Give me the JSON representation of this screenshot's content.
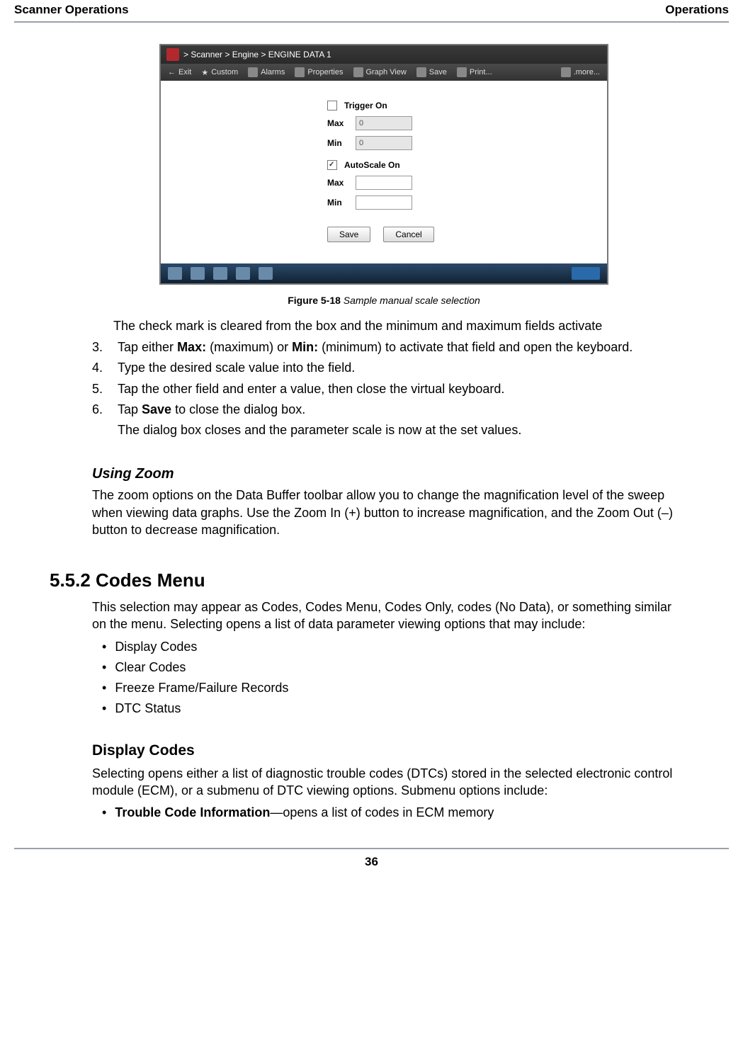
{
  "header": {
    "left": "Scanner Operations",
    "right": "Operations"
  },
  "figure": {
    "breadcrumb": "> Scanner  > Engine  > ENGINE DATA 1",
    "toolbar": {
      "exit": "Exit",
      "custom": "Custom",
      "alarms": "Alarms",
      "properties": "Properties",
      "graphview": "Graph View",
      "save": "Save",
      "print": "Print...",
      "more": ".more..."
    },
    "form": {
      "trigger_on": "Trigger On",
      "max": "Max",
      "min": "Min",
      "autoscale_on": "AutoScale On",
      "trigger_max_val": "0",
      "trigger_min_val": "0",
      "save_btn": "Save",
      "cancel_btn": "Cancel"
    },
    "caption_bold": "Figure 5-18",
    "caption_italic": " Sample manual scale selection"
  },
  "body": {
    "intro": "The check mark is cleared from the box and the minimum and maximum fields activate",
    "step3_num": "3.",
    "step3_a": "Tap either ",
    "step3_b": "Max:",
    "step3_c": " (maximum) or ",
    "step3_d": "Min:",
    "step3_e": " (minimum) to activate that field and open the keyboard.",
    "step4_num": "4.",
    "step4": "Type the desired scale value into the field.",
    "step5_num": "5.",
    "step5": "Tap the other field and enter a value, then close the virtual keyboard.",
    "step6_num": "6.",
    "step6_a": "Tap ",
    "step6_b": "Save",
    "step6_c": " to close the dialog box.",
    "step6_sub": "The dialog box closes and the parameter scale is now at the set values.",
    "zoom_h": "Using Zoom",
    "zoom_p": "The zoom options on the Data Buffer toolbar allow you to change the magnification level of the sweep when viewing data graphs. Use the Zoom In (+) button to increase magnification, and the Zoom Out (–) button to decrease magnification.",
    "sec_h": "5.5.2  Codes Menu",
    "sec_p": "This selection may appear as Codes, Codes Menu, Codes Only, codes (No Data), or something similar on the menu. Selecting opens a list of data parameter viewing options that may include:",
    "codes_list": [
      "Display Codes",
      "Clear Codes",
      "Freeze Frame/Failure Records",
      "DTC Status"
    ],
    "disp_h": "Display Codes",
    "disp_p": "Selecting opens either a list of diagnostic trouble codes (DTCs) stored in the selected electronic control module (ECM), or a submenu of DTC viewing options. Submenu options include:",
    "disp_item_b": "Trouble Code Information",
    "disp_item_rest": "—opens a list of codes in ECM memory"
  },
  "footer": {
    "page": "36"
  }
}
